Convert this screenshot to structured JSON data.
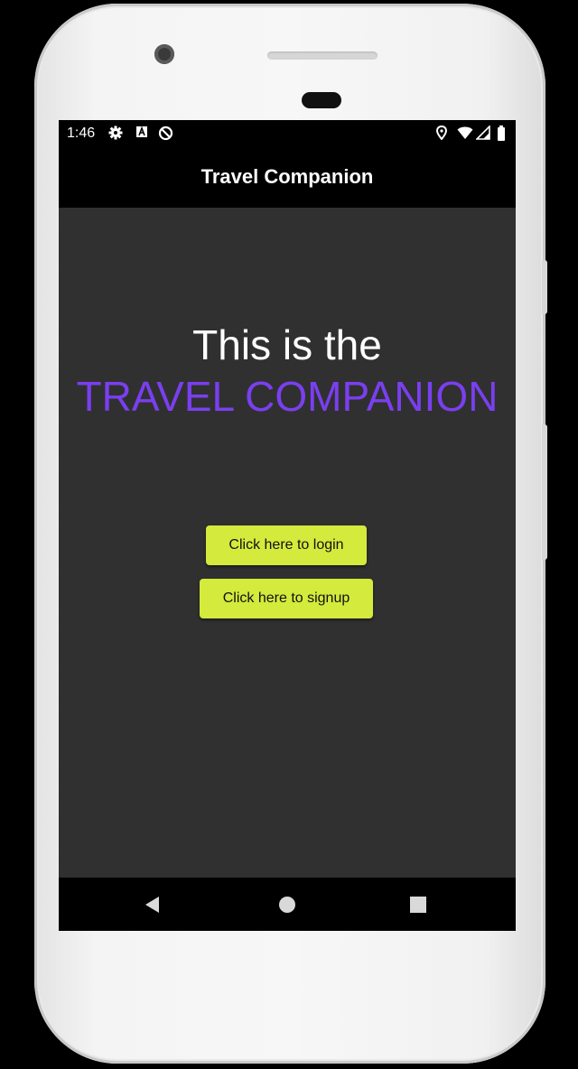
{
  "status_bar": {
    "time": "1:46",
    "icons": [
      "settings-gear-icon",
      "a-badge-icon",
      "data-saver-icon",
      "location-pin-icon",
      "wifi-icon",
      "signal-icon",
      "battery-icon"
    ]
  },
  "app_bar": {
    "title": "Travel Companion"
  },
  "main": {
    "headline": "This is the",
    "headline_accent": "TRAVEL COMPANION",
    "login_button": "Click here to login",
    "signup_button": "Click here to signup"
  },
  "nav_bar": {
    "icons": [
      "back-icon",
      "home-icon",
      "recents-icon"
    ]
  },
  "colors": {
    "accent_purple": "#7a3ff0",
    "button_lime": "#d4ea3c",
    "content_background": "#303030",
    "app_bar_background": "#000000"
  }
}
